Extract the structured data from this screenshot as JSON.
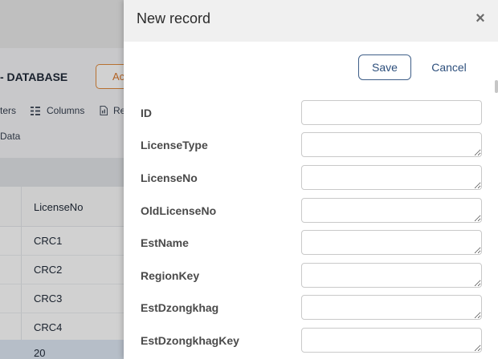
{
  "background": {
    "title": "- DATABASE",
    "action_button": "Ac",
    "toolbar": {
      "filters": "ters",
      "columns": "Columns",
      "reports": "Re"
    },
    "data_tab": "Data",
    "table": {
      "column_header": "LicenseNo",
      "rows": [
        "CRC1",
        "CRC2",
        "CRC3",
        "CRC4",
        "20"
      ]
    }
  },
  "drawer": {
    "title": "New record",
    "close_glyph": "×",
    "save_label": "Save",
    "cancel_label": "Cancel",
    "fields": [
      {
        "label": "ID",
        "value": ""
      },
      {
        "label": "LicenseType",
        "value": ""
      },
      {
        "label": "LicenseNo",
        "value": ""
      },
      {
        "label": "OldLicenseNo",
        "value": ""
      },
      {
        "label": "EstName",
        "value": ""
      },
      {
        "label": "RegionKey",
        "value": ""
      },
      {
        "label": "EstDzongkhag",
        "value": ""
      },
      {
        "label": "EstDzongkhagKey",
        "value": ""
      }
    ]
  },
  "colors": {
    "accent": "#2d4f7c",
    "action_orange": "#d9772a"
  }
}
